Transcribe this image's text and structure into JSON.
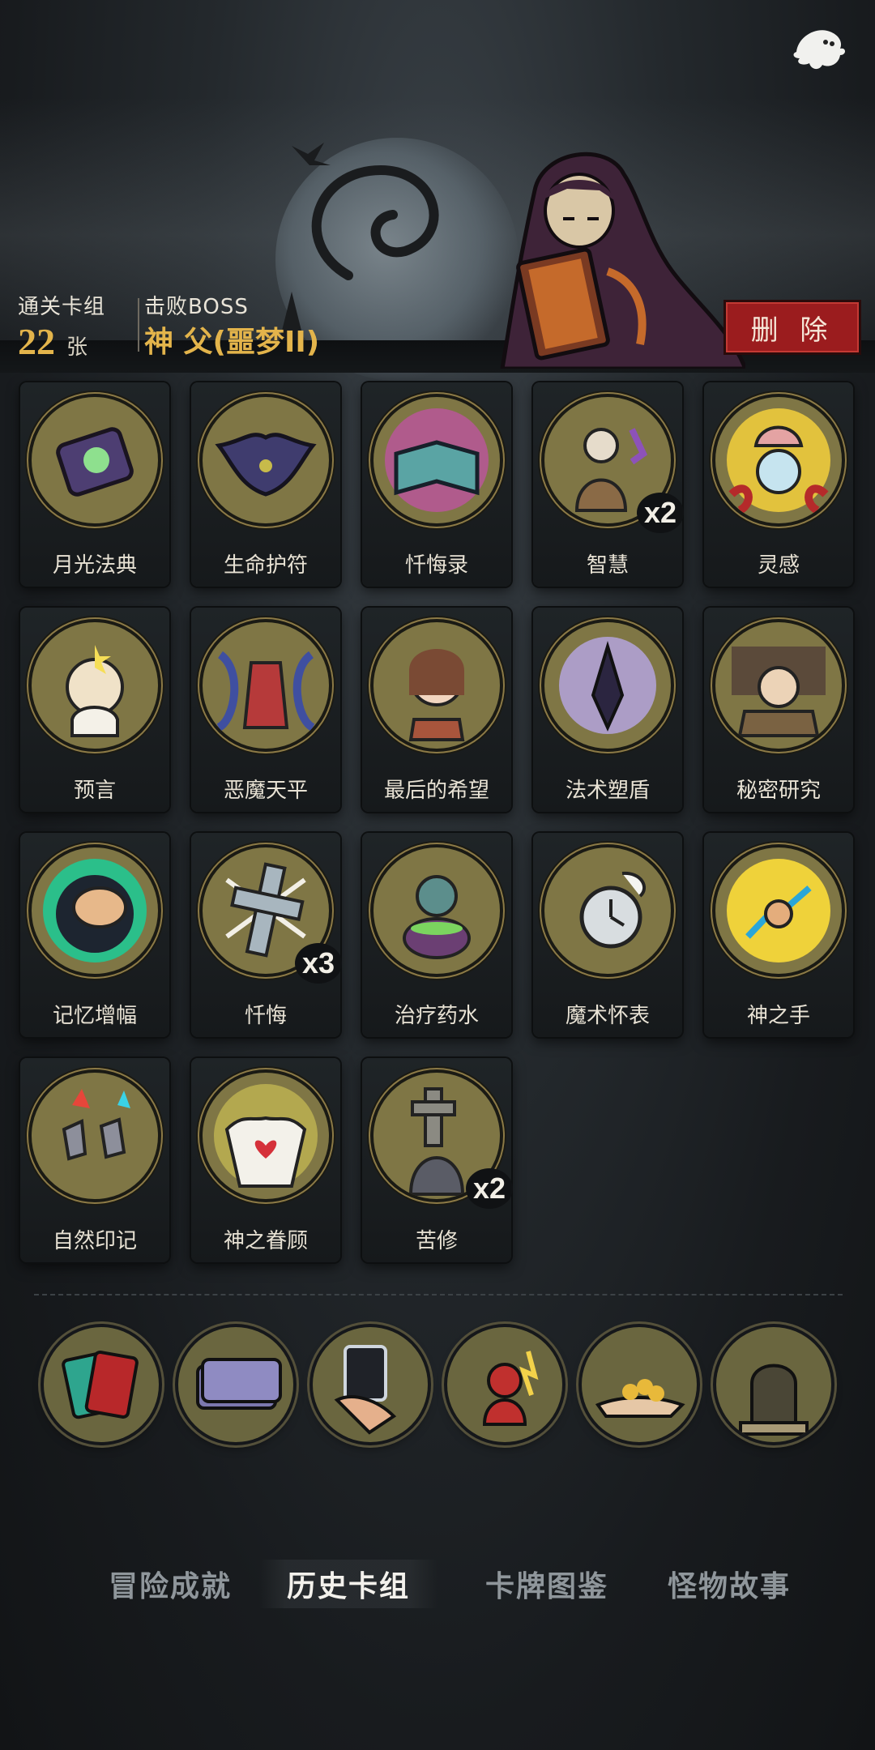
{
  "header": {
    "cleared_deck_label": "通关卡组",
    "cleared_deck_count": "22",
    "cleared_deck_unit": "张",
    "boss_label": "击败BOSS",
    "boss_name": "神 父(噩梦II)",
    "delete_label": "删 除"
  },
  "cards": [
    {
      "name": "月光法典",
      "icon": "moonlight-codex-icon",
      "count": ""
    },
    {
      "name": "生命护符",
      "icon": "bat-amulet-icon",
      "count": ""
    },
    {
      "name": "忏悔录",
      "icon": "confession-book-icon",
      "count": ""
    },
    {
      "name": "智慧",
      "icon": "sage-icon",
      "count": "x2"
    },
    {
      "name": "灵感",
      "icon": "brain-skull-icon",
      "count": ""
    },
    {
      "name": "预言",
      "icon": "prophet-icon",
      "count": ""
    },
    {
      "name": "恶魔天平",
      "icon": "demon-scale-icon",
      "count": ""
    },
    {
      "name": "最后的希望",
      "icon": "girl-icon",
      "count": ""
    },
    {
      "name": "法术塑盾",
      "icon": "spell-shield-icon",
      "count": ""
    },
    {
      "name": "秘密研究",
      "icon": "scholar-icon",
      "count": ""
    },
    {
      "name": "记忆增幅",
      "icon": "brain-glow-icon",
      "count": ""
    },
    {
      "name": "忏悔",
      "icon": "cross-icon",
      "count": "x3"
    },
    {
      "name": "治疗药水",
      "icon": "potion-zombie-icon",
      "count": ""
    },
    {
      "name": "魔术怀表",
      "icon": "pocket-watch-icon",
      "count": ""
    },
    {
      "name": "神之手",
      "icon": "lightning-hand-icon",
      "count": ""
    },
    {
      "name": "自然印记",
      "icon": "element-stones-icon",
      "count": ""
    },
    {
      "name": "神之眷顾",
      "icon": "angel-heart-icon",
      "count": ""
    },
    {
      "name": "苦修",
      "icon": "pilgrim-icon",
      "count": "x2"
    }
  ],
  "relics": [
    {
      "icon": "card-deck-icon"
    },
    {
      "icon": "card-stack-icon"
    },
    {
      "icon": "hand-cards-icon"
    },
    {
      "icon": "red-demon-icon"
    },
    {
      "icon": "gold-coins-hand-icon"
    },
    {
      "icon": "gargoyle-icon"
    }
  ],
  "nav": {
    "achievements": "冒险成就",
    "history_decks": "历史卡组",
    "card_codex": "卡牌图鉴",
    "monster_stories": "怪物故事"
  },
  "colors": {
    "accent_gold": "#e3b44b",
    "delete_red": "#9b1c1e",
    "medal_olive": "#7f7645"
  }
}
